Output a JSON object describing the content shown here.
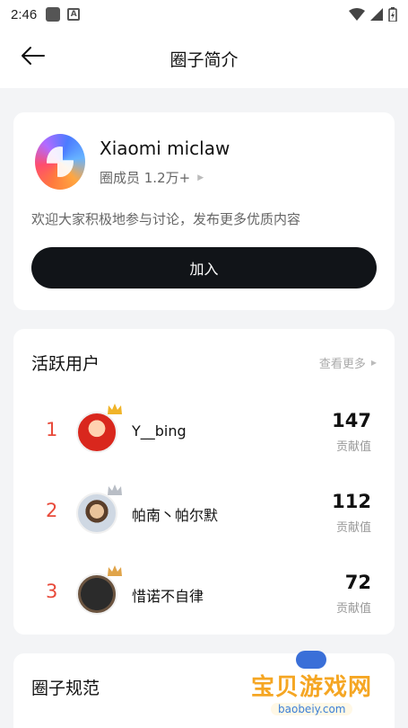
{
  "status_bar": {
    "time": "2:46"
  },
  "header": {
    "title": "圈子简介"
  },
  "circle": {
    "name": "Xiaomi miclaw",
    "members": "圈成员 1.2万+",
    "intro": "欢迎大家积极地参与讨论，发布更多优质内容",
    "join_label": "加入"
  },
  "active_users": {
    "title": "活跃用户",
    "see_more": "查看更多",
    "users": [
      {
        "rank": "1",
        "name": "Y__bing",
        "score": "147",
        "score_label": "贡献值"
      },
      {
        "rank": "2",
        "name": "帕南丶帕尔默",
        "score": "112",
        "score_label": "贡献值"
      },
      {
        "rank": "3",
        "name": "惜诺不自律",
        "score": "72",
        "score_label": "贡献值"
      }
    ]
  },
  "rules": {
    "title": "圈子规范"
  },
  "watermark": {
    "title": "宝贝游戏网",
    "url": "baobeiy.com"
  },
  "colors": {
    "accent": "#e84a3a",
    "button": "#111418",
    "crown_gold": "#f0b429",
    "crown_silver": "#b9bec6"
  }
}
